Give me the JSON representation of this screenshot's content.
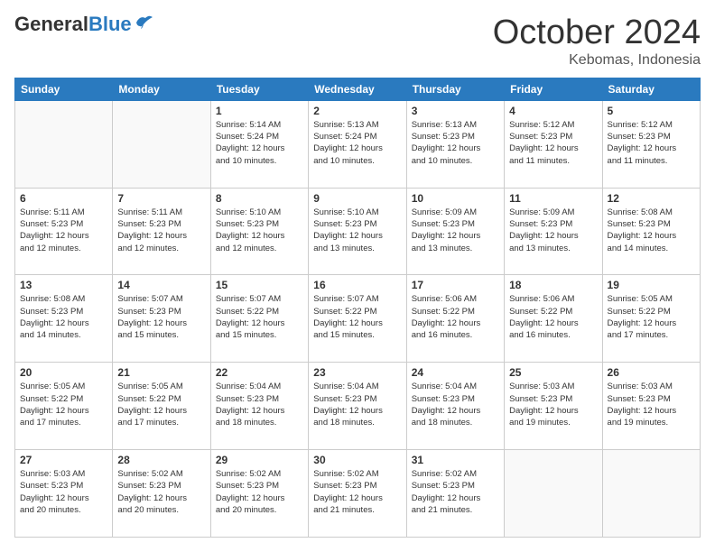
{
  "logo": {
    "general": "General",
    "blue": "Blue"
  },
  "header": {
    "month": "October 2024",
    "location": "Kebomas, Indonesia"
  },
  "weekdays": [
    "Sunday",
    "Monday",
    "Tuesday",
    "Wednesday",
    "Thursday",
    "Friday",
    "Saturday"
  ],
  "weeks": [
    [
      {
        "day": "",
        "lines": []
      },
      {
        "day": "",
        "lines": []
      },
      {
        "day": "1",
        "lines": [
          "Sunrise: 5:14 AM",
          "Sunset: 5:24 PM",
          "Daylight: 12 hours",
          "and 10 minutes."
        ]
      },
      {
        "day": "2",
        "lines": [
          "Sunrise: 5:13 AM",
          "Sunset: 5:24 PM",
          "Daylight: 12 hours",
          "and 10 minutes."
        ]
      },
      {
        "day": "3",
        "lines": [
          "Sunrise: 5:13 AM",
          "Sunset: 5:23 PM",
          "Daylight: 12 hours",
          "and 10 minutes."
        ]
      },
      {
        "day": "4",
        "lines": [
          "Sunrise: 5:12 AM",
          "Sunset: 5:23 PM",
          "Daylight: 12 hours",
          "and 11 minutes."
        ]
      },
      {
        "day": "5",
        "lines": [
          "Sunrise: 5:12 AM",
          "Sunset: 5:23 PM",
          "Daylight: 12 hours",
          "and 11 minutes."
        ]
      }
    ],
    [
      {
        "day": "6",
        "lines": [
          "Sunrise: 5:11 AM",
          "Sunset: 5:23 PM",
          "Daylight: 12 hours",
          "and 12 minutes."
        ]
      },
      {
        "day": "7",
        "lines": [
          "Sunrise: 5:11 AM",
          "Sunset: 5:23 PM",
          "Daylight: 12 hours",
          "and 12 minutes."
        ]
      },
      {
        "day": "8",
        "lines": [
          "Sunrise: 5:10 AM",
          "Sunset: 5:23 PM",
          "Daylight: 12 hours",
          "and 12 minutes."
        ]
      },
      {
        "day": "9",
        "lines": [
          "Sunrise: 5:10 AM",
          "Sunset: 5:23 PM",
          "Daylight: 12 hours",
          "and 13 minutes."
        ]
      },
      {
        "day": "10",
        "lines": [
          "Sunrise: 5:09 AM",
          "Sunset: 5:23 PM",
          "Daylight: 12 hours",
          "and 13 minutes."
        ]
      },
      {
        "day": "11",
        "lines": [
          "Sunrise: 5:09 AM",
          "Sunset: 5:23 PM",
          "Daylight: 12 hours",
          "and 13 minutes."
        ]
      },
      {
        "day": "12",
        "lines": [
          "Sunrise: 5:08 AM",
          "Sunset: 5:23 PM",
          "Daylight: 12 hours",
          "and 14 minutes."
        ]
      }
    ],
    [
      {
        "day": "13",
        "lines": [
          "Sunrise: 5:08 AM",
          "Sunset: 5:23 PM",
          "Daylight: 12 hours",
          "and 14 minutes."
        ]
      },
      {
        "day": "14",
        "lines": [
          "Sunrise: 5:07 AM",
          "Sunset: 5:23 PM",
          "Daylight: 12 hours",
          "and 15 minutes."
        ]
      },
      {
        "day": "15",
        "lines": [
          "Sunrise: 5:07 AM",
          "Sunset: 5:22 PM",
          "Daylight: 12 hours",
          "and 15 minutes."
        ]
      },
      {
        "day": "16",
        "lines": [
          "Sunrise: 5:07 AM",
          "Sunset: 5:22 PM",
          "Daylight: 12 hours",
          "and 15 minutes."
        ]
      },
      {
        "day": "17",
        "lines": [
          "Sunrise: 5:06 AM",
          "Sunset: 5:22 PM",
          "Daylight: 12 hours",
          "and 16 minutes."
        ]
      },
      {
        "day": "18",
        "lines": [
          "Sunrise: 5:06 AM",
          "Sunset: 5:22 PM",
          "Daylight: 12 hours",
          "and 16 minutes."
        ]
      },
      {
        "day": "19",
        "lines": [
          "Sunrise: 5:05 AM",
          "Sunset: 5:22 PM",
          "Daylight: 12 hours",
          "and 17 minutes."
        ]
      }
    ],
    [
      {
        "day": "20",
        "lines": [
          "Sunrise: 5:05 AM",
          "Sunset: 5:22 PM",
          "Daylight: 12 hours",
          "and 17 minutes."
        ]
      },
      {
        "day": "21",
        "lines": [
          "Sunrise: 5:05 AM",
          "Sunset: 5:22 PM",
          "Daylight: 12 hours",
          "and 17 minutes."
        ]
      },
      {
        "day": "22",
        "lines": [
          "Sunrise: 5:04 AM",
          "Sunset: 5:23 PM",
          "Daylight: 12 hours",
          "and 18 minutes."
        ]
      },
      {
        "day": "23",
        "lines": [
          "Sunrise: 5:04 AM",
          "Sunset: 5:23 PM",
          "Daylight: 12 hours",
          "and 18 minutes."
        ]
      },
      {
        "day": "24",
        "lines": [
          "Sunrise: 5:04 AM",
          "Sunset: 5:23 PM",
          "Daylight: 12 hours",
          "and 18 minutes."
        ]
      },
      {
        "day": "25",
        "lines": [
          "Sunrise: 5:03 AM",
          "Sunset: 5:23 PM",
          "Daylight: 12 hours",
          "and 19 minutes."
        ]
      },
      {
        "day": "26",
        "lines": [
          "Sunrise: 5:03 AM",
          "Sunset: 5:23 PM",
          "Daylight: 12 hours",
          "and 19 minutes."
        ]
      }
    ],
    [
      {
        "day": "27",
        "lines": [
          "Sunrise: 5:03 AM",
          "Sunset: 5:23 PM",
          "Daylight: 12 hours",
          "and 20 minutes."
        ]
      },
      {
        "day": "28",
        "lines": [
          "Sunrise: 5:02 AM",
          "Sunset: 5:23 PM",
          "Daylight: 12 hours",
          "and 20 minutes."
        ]
      },
      {
        "day": "29",
        "lines": [
          "Sunrise: 5:02 AM",
          "Sunset: 5:23 PM",
          "Daylight: 12 hours",
          "and 20 minutes."
        ]
      },
      {
        "day": "30",
        "lines": [
          "Sunrise: 5:02 AM",
          "Sunset: 5:23 PM",
          "Daylight: 12 hours",
          "and 21 minutes."
        ]
      },
      {
        "day": "31",
        "lines": [
          "Sunrise: 5:02 AM",
          "Sunset: 5:23 PM",
          "Daylight: 12 hours",
          "and 21 minutes."
        ]
      },
      {
        "day": "",
        "lines": []
      },
      {
        "day": "",
        "lines": []
      }
    ]
  ]
}
